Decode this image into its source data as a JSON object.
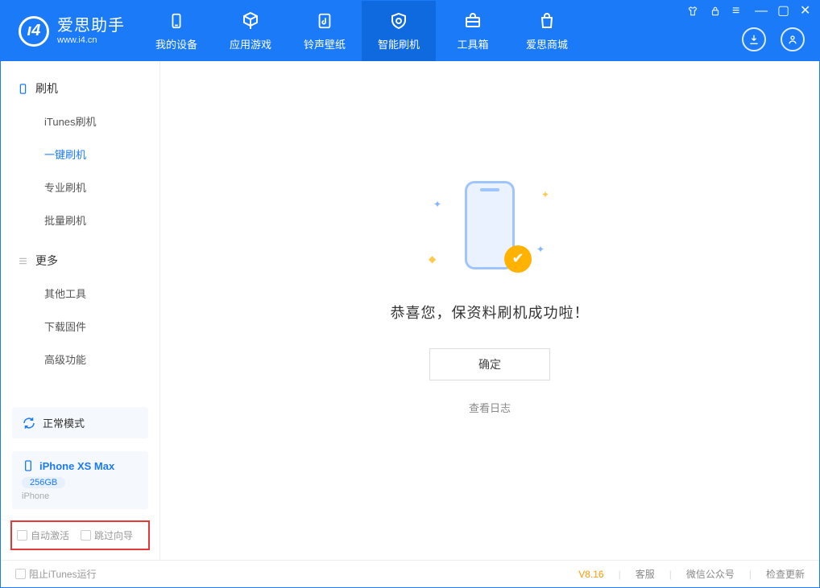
{
  "app": {
    "title": "爱思助手",
    "site": "www.i4.cn"
  },
  "nav": {
    "items": [
      {
        "label": "我的设备"
      },
      {
        "label": "应用游戏"
      },
      {
        "label": "铃声壁纸"
      },
      {
        "label": "智能刷机"
      },
      {
        "label": "工具箱"
      },
      {
        "label": "爱思商城"
      }
    ]
  },
  "sidebar": {
    "group1_title": "刷机",
    "group1_items": [
      "iTunes刷机",
      "一键刷机",
      "专业刷机",
      "批量刷机"
    ],
    "group2_title": "更多",
    "group2_items": [
      "其他工具",
      "下载固件",
      "高级功能"
    ],
    "mode_label": "正常模式",
    "device_name": "iPhone XS Max",
    "device_storage": "256GB",
    "device_type": "iPhone",
    "check_auto_activate": "自动激活",
    "check_skip_guide": "跳过向导"
  },
  "main": {
    "success_text": "恭喜您，保资料刷机成功啦！",
    "ok_button": "确定",
    "view_log": "查看日志"
  },
  "status": {
    "block_itunes": "阻止iTunes运行",
    "version": "V8.16",
    "link_service": "客服",
    "link_wechat": "微信公众号",
    "link_update": "检查更新"
  }
}
